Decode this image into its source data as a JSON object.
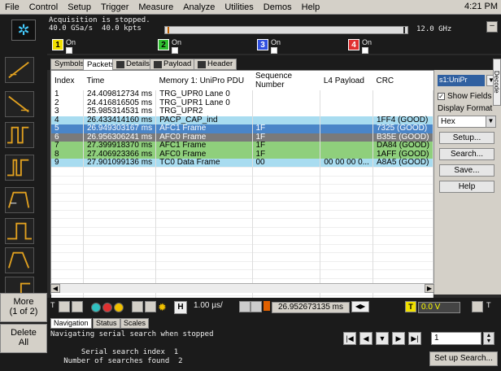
{
  "menu": [
    "File",
    "Control",
    "Setup",
    "Trigger",
    "Measure",
    "Analyze",
    "Utilities",
    "Demos",
    "Help"
  ],
  "clock": "4:21 PM",
  "acquisition": {
    "line1": "Acquisition is stopped.",
    "line2": "40.0 GSa/s  40.0 kpts",
    "freq": "12.0 GHz"
  },
  "channels": [
    {
      "num": "1",
      "label": "On",
      "color": "#f0e000"
    },
    {
      "num": "2",
      "label": "On",
      "color": "#30c030"
    },
    {
      "num": "3",
      "label": "On",
      "color": "#3050e0"
    },
    {
      "num": "4",
      "label": "On",
      "color": "#e03030"
    }
  ],
  "tabs": [
    "Symbols",
    "Packets",
    "Details",
    "Payload",
    "Header"
  ],
  "table": {
    "headers": [
      "Index",
      "Time",
      "Memory 1: UniPro PDU",
      "Sequence Number",
      "L4 Payload",
      "CRC"
    ],
    "rows": [
      {
        "style": "white",
        "cells": [
          "1",
          "24.409812734 ms",
          "TRG_UPR0 Lane 0",
          "",
          "",
          ""
        ]
      },
      {
        "style": "white",
        "cells": [
          "2",
          "24.416816505 ms",
          "TRG_UPR1 Lane 0",
          "",
          "",
          ""
        ]
      },
      {
        "style": "white",
        "cells": [
          "3",
          "25.985314531 ms",
          "TRG_UPR2",
          "",
          "",
          ""
        ]
      },
      {
        "style": "cyan",
        "cells": [
          "4",
          "26.433414160 ms",
          "PACP_CAP_ind",
          "",
          "",
          "1FF4 (GOOD)"
        ]
      },
      {
        "style": "sel",
        "cells": [
          "5",
          "26.949303167 ms",
          "AFC1 Frame",
          "1F",
          "",
          "7325 (GOOD)"
        ]
      },
      {
        "style": "dgrey",
        "cells": [
          "6",
          "26.956306241 ms",
          "AFC0 Frame",
          "1F",
          "",
          "B35E (GOOD)"
        ]
      },
      {
        "style": "green",
        "cells": [
          "7",
          "27.399918370 ms",
          "AFC1 Frame",
          "1F",
          "",
          "DA84 (GOOD)"
        ]
      },
      {
        "style": "green",
        "cells": [
          "8",
          "27.406923366 ms",
          "AFC0 Frame",
          "1F",
          "",
          "1AFF (GOOD)"
        ]
      },
      {
        "style": "cyan",
        "cells": [
          "9",
          "27.901099136 ms",
          "TC0 Data Frame",
          "00",
          "00 00 00 0...",
          "A8A5 (GOOD)"
        ]
      }
    ]
  },
  "right_panel": {
    "source": "s1:UniPr",
    "show_fields": "Show Fields",
    "display_format_label": "Display Format",
    "display_format_value": "Hex",
    "buttons": [
      "Setup...",
      "Search...",
      "Save...",
      "Help"
    ],
    "decode_tab": "Decode"
  },
  "left_buttons": {
    "more": "More",
    "more_page": "(1 of 2)",
    "delete": "Delete",
    "delete2": "All"
  },
  "bottom": {
    "time_div": "1.00 µs/",
    "trigger_pos": "26.952673135 ms",
    "voltage": "0.0 V"
  },
  "nav_tabs": [
    "Navigation",
    "Status",
    "Scales"
  ],
  "console": {
    "line1": "Navigating serial search when stopped",
    "line2": "       Serial search index  1",
    "line3": "   Number of searches found  2"
  },
  "nav": {
    "index_value": "1",
    "setup_search": "Set up Search..."
  }
}
